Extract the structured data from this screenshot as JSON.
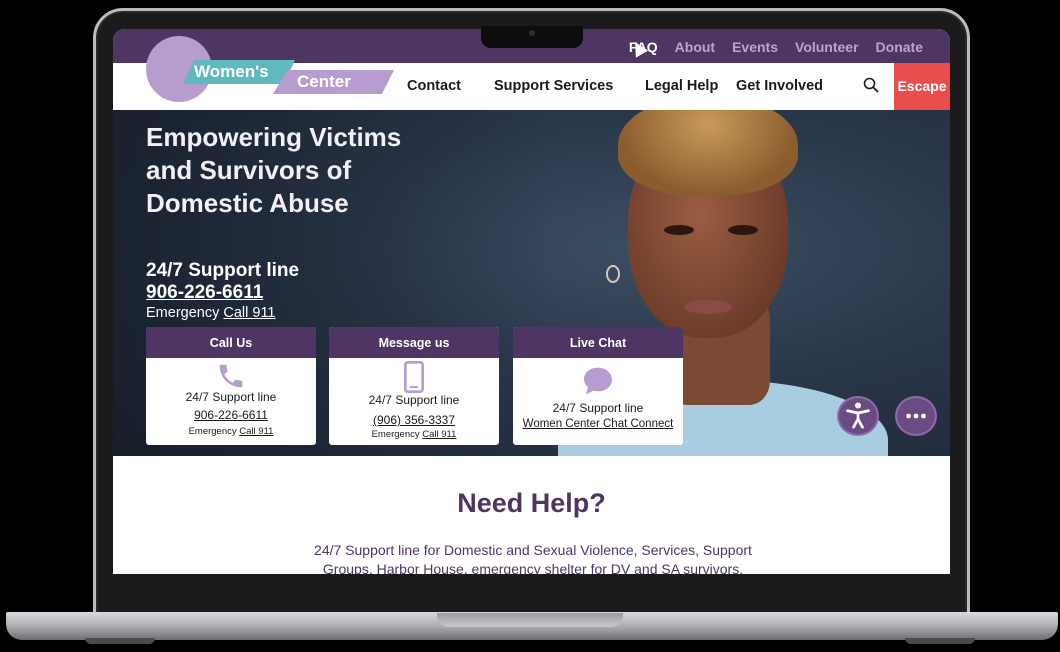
{
  "top_links": [
    "FAQ",
    "About",
    "Events",
    "Volunteer",
    "Donate"
  ],
  "logo": {
    "line1": "Women's",
    "line2": "Center"
  },
  "nav": {
    "items": [
      "Contact",
      "Support Services",
      "Legal Help",
      "Get Involved"
    ],
    "escape_label": "Escape"
  },
  "hero": {
    "title": "Empowering Victims and Survivors of Domestic Abuse",
    "support_label": "24/7 Support line",
    "phone": "906-226-6611",
    "emergency_prefix": "Emergency",
    "emergency_link": "Call 911"
  },
  "cards": [
    {
      "title": "Call Us",
      "line": "24/7 Support line",
      "link": "906-226-6611",
      "emergency_prefix": "Emergency",
      "emergency_link": "Call 911",
      "icon": "phone-icon"
    },
    {
      "title": "Message us",
      "line": "24/7 Support line",
      "link": "(906) 356-3337",
      "emergency_prefix": "Emergency",
      "emergency_link": "Call 911",
      "icon": "mobile-icon"
    },
    {
      "title": "Live Chat",
      "line": "24/7 Support line",
      "link": "Women Center Chat Connect",
      "icon": "chat-bubble-icon"
    }
  ],
  "help": {
    "title": "Need Help?",
    "text": "24/7 Support line for Domestic and Sexual Violence, Services, Support Groups, Harbor House, emergency shelter for DV and SA survivors."
  },
  "colors": {
    "brand_purple": "#4e3563",
    "light_purple": "#b69ccf",
    "teal": "#5fb9bf",
    "escape_red": "#e84e4e"
  }
}
